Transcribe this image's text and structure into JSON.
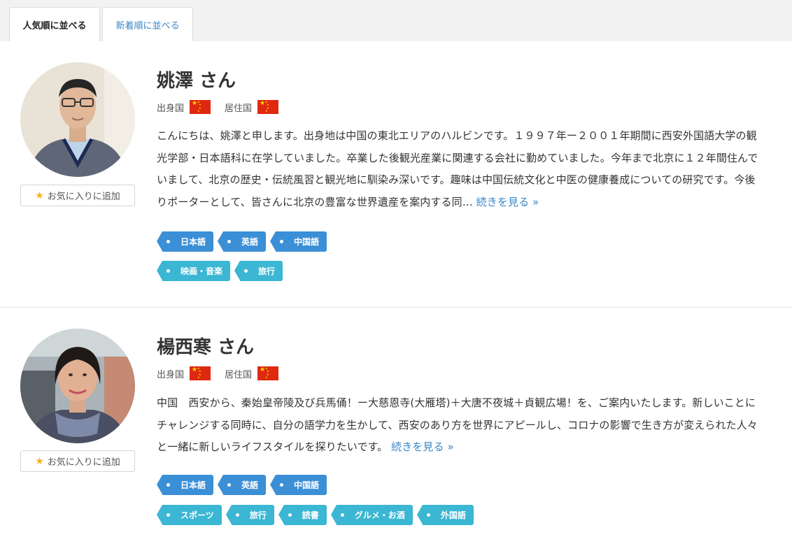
{
  "tabs": [
    {
      "label": "人気順に並べる",
      "active": true
    },
    {
      "label": "新着順に並べる",
      "active": false
    }
  ],
  "colors": {
    "language_tag": "#3b8fd6",
    "hobby_tag": "#3bb6d3",
    "link": "#3a86c8"
  },
  "profiles": [
    {
      "name": "姚澤 さん",
      "origin_label": "出身国",
      "residence_label": "居住国",
      "origin_flag": "china-flag-icon",
      "residence_flag": "china-flag-icon",
      "favorite_label": "お気に入りに追加",
      "bio": "こんにちは、姚澤と申します。出身地は中国の東北エリアのハルビンです。１９９７年ー２００１年期間に西安外国語大学の観光学部・日本語科に在学していました。卒業した後観光産業に関連する会社に勤めていました。今年まで北京に１２年間住んでいまして、北京の歴史・伝統風習と観光地に馴染み深いです。趣味は中国伝統文化と中医の健康養成についての研究です。今後りポーターとして、皆さんに北京の豊富な世界遺産を案内する同… ",
      "more_label": "続きを見る »",
      "languages": [
        "日本語",
        "英語",
        "中国語"
      ],
      "hobbies": [
        "映画・音楽",
        "旅行"
      ]
    },
    {
      "name": "楊西寒 さん",
      "origin_label": "出身国",
      "residence_label": "居住国",
      "origin_flag": "china-flag-icon",
      "residence_flag": "china-flag-icon",
      "favorite_label": "お気に入りに追加",
      "bio": "中国　西安から、秦始皇帝陵及び兵馬俑！ー大慈恩寺(大雁塔)＋大唐不夜城＋貞観広場！を、ご案内いたします。新しいことにチャレンジする同時に、自分の語学力を生かして、西安のあり方を世界にアピールし、コロナの影響で生き方が変えられた人々と一緒に新しいライフスタイルを探りたいです。 ",
      "more_label": "続きを見る »",
      "languages": [
        "日本語",
        "英語",
        "中国語"
      ],
      "hobbies": [
        "スポーツ",
        "旅行",
        "読書",
        "グルメ・お酒",
        "外国語"
      ]
    }
  ]
}
